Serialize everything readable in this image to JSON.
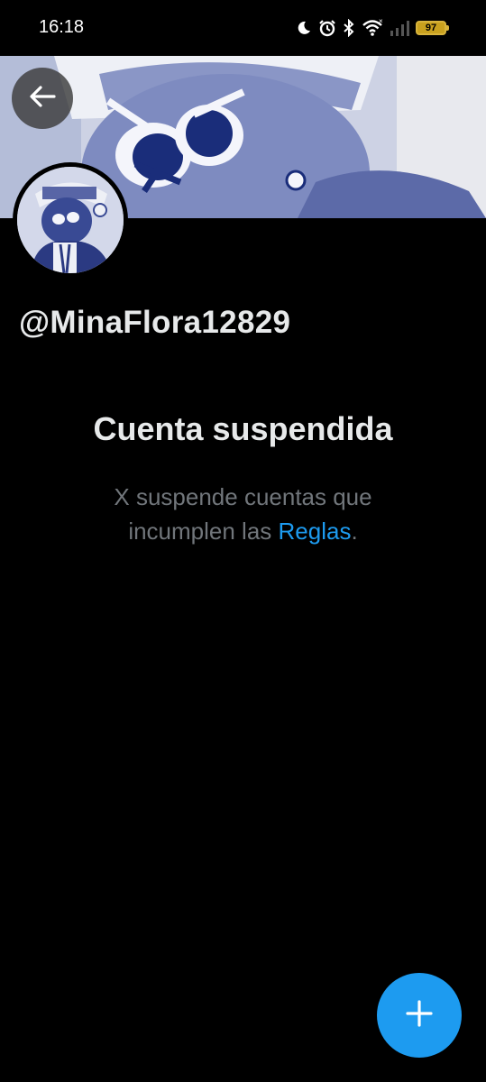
{
  "status_bar": {
    "time": "16:18",
    "battery_level": "97",
    "icons": [
      "moon-icon",
      "alarm-icon",
      "bluetooth-icon",
      "wifi-icon",
      "signal-icon",
      "battery-icon"
    ]
  },
  "profile": {
    "handle": "@MinaFlora12829"
  },
  "suspension": {
    "title": "Cuenta suspendida",
    "message_before": "X suspende cuentas que incumplen las ",
    "rules_link": "Reglas",
    "message_after": "."
  },
  "colors": {
    "background": "#000000",
    "accent": "#1d9bf0",
    "secondary_text": "#71767b",
    "primary_text": "#e7e9ea"
  }
}
